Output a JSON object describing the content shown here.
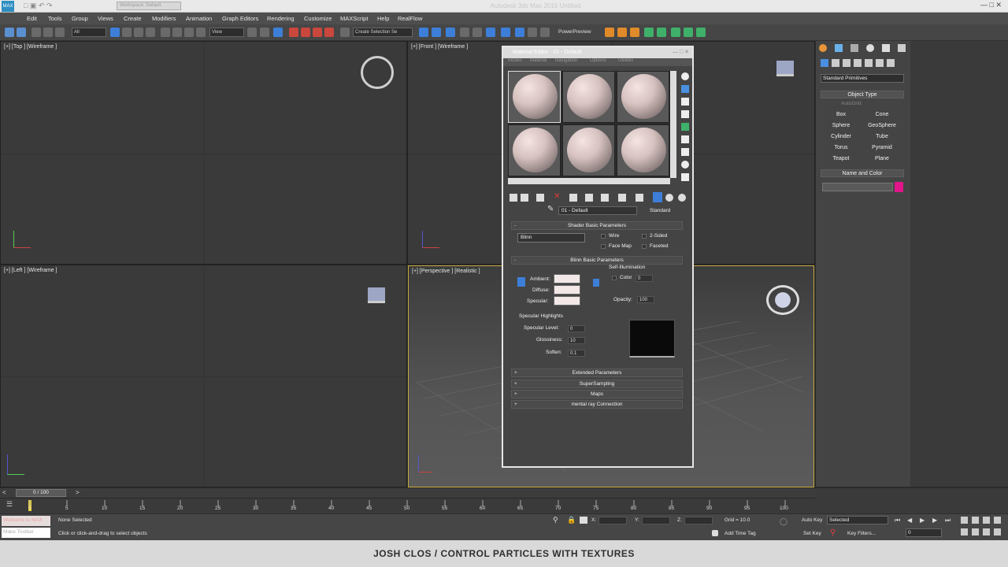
{
  "app": {
    "window_title": "Autodesk 3ds Max 2015 Untitled",
    "logo_text": "MAX",
    "workspace": "Workspace: Default"
  },
  "menu": [
    "Edit",
    "Tools",
    "Group",
    "Views",
    "Create",
    "Modifiers",
    "Animation",
    "Graph Editors",
    "Rendering",
    "Customize",
    "MAXScript",
    "Help",
    "RealFlow"
  ],
  "toolbar": {
    "filter": "All",
    "ref_coord": "View",
    "selection_set": "Create Selection Se",
    "powerpreview": "PowerPreview"
  },
  "viewports": {
    "top": "[+] [Top ] [Wireframe ]",
    "front": "[+] [Front ] [Wireframe ]",
    "left": "[+] [Left ] [Wireframe ]",
    "perspective": "[+] [Perspective ] [Realistic ]"
  },
  "command_panel": {
    "category": "Standard Primitives",
    "object_type_header": "Object Type",
    "autogrid": "AutoGrid",
    "buttons": [
      "Box",
      "Cone",
      "Sphere",
      "GeoSphere",
      "Cylinder",
      "Tube",
      "Torus",
      "Pyramid",
      "Teapot",
      "Plane"
    ],
    "name_color_header": "Name and Color",
    "swatch_color": "#e0158a"
  },
  "material_editor": {
    "title": "Material Editor - 01 - Default",
    "menus": [
      "Modes",
      "Material",
      "Navigation",
      "Options",
      "Utilities"
    ],
    "material_name": "01 - Default",
    "material_type": "Standard",
    "shader_section": "Shader Basic Parameters",
    "shader": "Blinn",
    "wire": "Wire",
    "two_sided": "2-Sided",
    "face_map": "Face Map",
    "faceted": "Faceted",
    "blinn_section": "Blinn Basic Parameters",
    "self_illum": "Self-Illumination",
    "color_label": "Color",
    "color_value": "0",
    "ambient": "Ambient:",
    "diffuse": "Diffuse:",
    "specular": "Specular:",
    "opacity_label": "Opacity:",
    "opacity_value": "100",
    "spec_highlights": "Specular Highlights",
    "spec_level_label": "Specular Level:",
    "spec_level": "0",
    "glossiness_label": "Glossiness:",
    "glossiness": "10",
    "soften_label": "Soften:",
    "soften": "0.1",
    "rollouts": [
      "Extended Parameters",
      "SuperSampling",
      "Maps",
      "mental ray Connection"
    ]
  },
  "timeline": {
    "frame": "0 / 100",
    "ticks": [
      "0",
      "5",
      "10",
      "15",
      "20",
      "25",
      "30",
      "35",
      "40",
      "45",
      "50",
      "55",
      "60",
      "65",
      "70",
      "75",
      "80",
      "85",
      "90",
      "95",
      "100"
    ]
  },
  "status": {
    "maxscript_top": "Welcome to MAX",
    "maxscript_bottom": "Make Toolbar",
    "selection": "None Selected",
    "prompt": "Click or click-and-drag to select objects",
    "x_label": "X:",
    "y_label": "Y:",
    "z_label": "Z:",
    "grid": "Grid = 10.0",
    "add_time_tag": "Add Time Tag",
    "auto_key": "Auto Key",
    "set_key": "Set Key",
    "key_mode": "Selected",
    "key_filters": "Key Filters...",
    "frame_field": "0"
  },
  "caption": "JOSH CLOS / CONTROL PARTICLES WITH TEXTURES"
}
